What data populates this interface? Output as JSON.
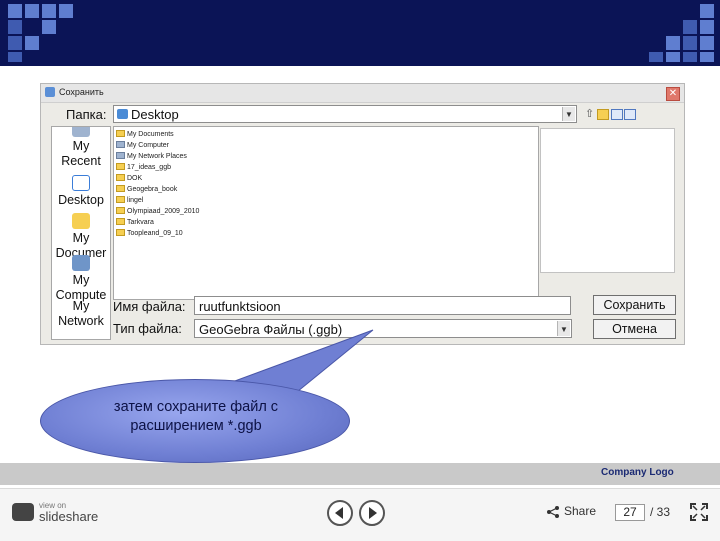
{
  "dialog": {
    "title": "Сохранить",
    "close_glyph": "✕",
    "folder_label": "Папка:",
    "folder_value": "Desktop",
    "places": [
      {
        "label1": "My",
        "label2": "Recent"
      },
      {
        "label1": "Desktop",
        "label2": ""
      },
      {
        "label1": "My",
        "label2": "Documer"
      },
      {
        "label1": "My",
        "label2": "Compute"
      },
      {
        "label1": "My",
        "label2": "Network"
      }
    ],
    "files": [
      "My Documents",
      "My Computer",
      "My Network Places",
      "17_ideas_ggb",
      "DOK",
      "Geogebra_book",
      "lingel",
      "Olympiaad_2009_2010",
      "Tarkvara",
      "Toopleand_09_10"
    ],
    "filename_label": "Имя файла:",
    "filename_value": "ruutfunktsioon",
    "filetype_label": "Тип файла:",
    "filetype_value": "GeoGebra Файлы (.ggb)",
    "save_button": "Сохранить",
    "cancel_button": "Отмена"
  },
  "callout": {
    "line1": "затем сохраните файл с",
    "line2": "расширением *.ggb"
  },
  "footer": {
    "company": "Company  Logo"
  },
  "player": {
    "view_on": "view on",
    "brand": "slideshare",
    "share": "Share",
    "page_current": "27",
    "page_total": "/ 33"
  },
  "colors": {
    "header": "#0b1456",
    "header_square": "#3f5bb0",
    "callout": "#6f7fd3",
    "footer": "#c9c9c9",
    "company": "#1b2a73"
  }
}
